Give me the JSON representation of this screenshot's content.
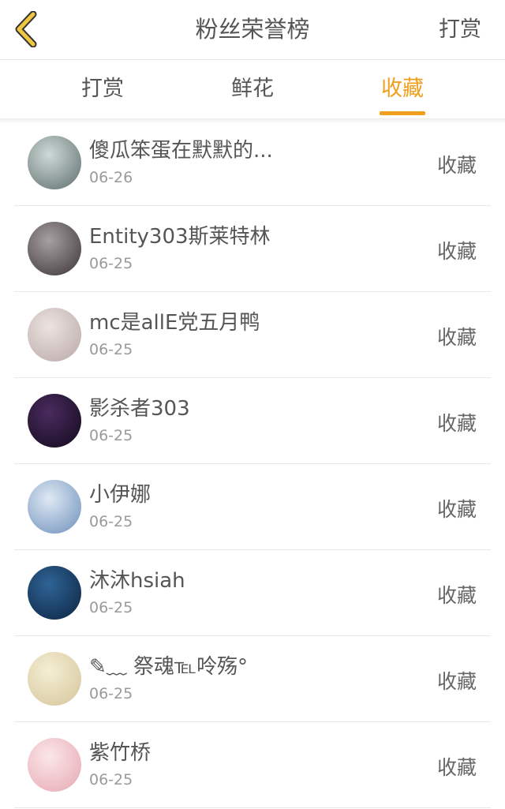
{
  "header": {
    "title": "粉丝荣誉榜",
    "action_label": "打赏",
    "back_icon": "chevron-left-icon",
    "accent_color": "#f0a01e"
  },
  "tabs": [
    {
      "label": "打赏",
      "active": false
    },
    {
      "label": "鲜花",
      "active": false
    },
    {
      "label": "收藏",
      "active": true
    }
  ],
  "fans": [
    {
      "name": "傻瓜笨蛋在默默的...",
      "date": "06-26",
      "type": "收藏",
      "avatar": {
        "bg1": "#cfd9d7",
        "bg2": "#5c6e6c"
      }
    },
    {
      "name": "Entity303斯莱特林",
      "date": "06-25",
      "type": "收藏",
      "avatar": {
        "bg1": "#a7a0a2",
        "bg2": "#3b3335"
      }
    },
    {
      "name": "mc是allE党五月鸭",
      "date": "06-25",
      "type": "收藏",
      "avatar": {
        "bg1": "#ece3e1",
        "bg2": "#b8a8a6"
      }
    },
    {
      "name": "影杀者303",
      "date": "06-25",
      "type": "收藏",
      "avatar": {
        "bg1": "#4a2b5e",
        "bg2": "#120a1c"
      }
    },
    {
      "name": "小伊娜",
      "date": "06-25",
      "type": "收藏",
      "avatar": {
        "bg1": "#dfe9f4",
        "bg2": "#6c8fbb"
      }
    },
    {
      "name": "沐沐hsiah",
      "date": "06-25",
      "type": "收藏",
      "avatar": {
        "bg1": "#2f6496",
        "bg2": "#0c2340"
      }
    },
    {
      "name": "✎﹏ 祭魂℡呤殇°",
      "date": "06-25",
      "type": "收藏",
      "avatar": {
        "bg1": "#f4efd4",
        "bg2": "#d6c49a"
      }
    },
    {
      "name": "紫竹桥",
      "date": "06-25",
      "type": "收藏",
      "avatar": {
        "bg1": "#fbe7ea",
        "bg2": "#e6a7b0"
      }
    }
  ]
}
